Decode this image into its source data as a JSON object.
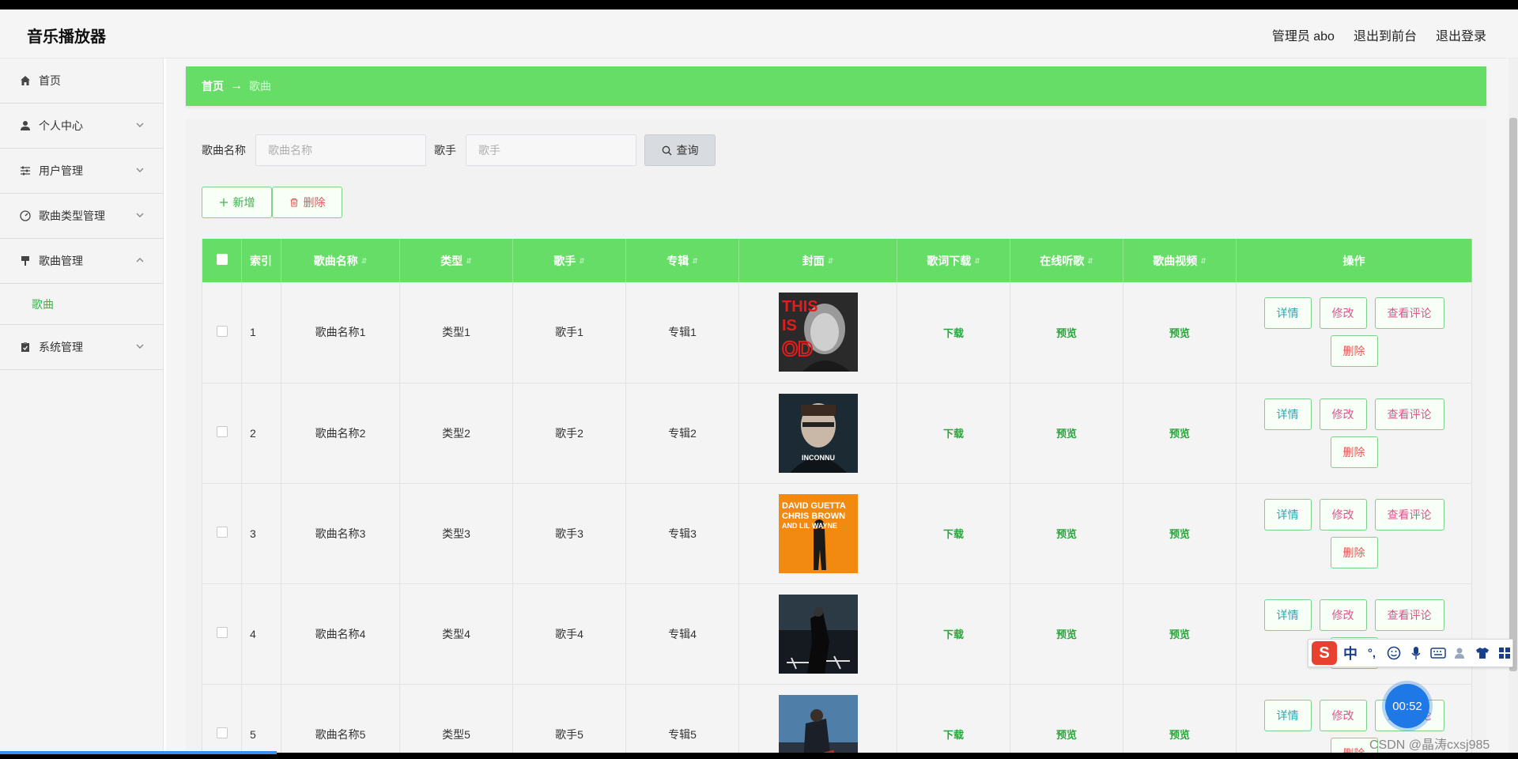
{
  "header": {
    "app_title": "音乐播放器",
    "admin_label": "管理员 abo",
    "to_front": "退出到前台",
    "logout": "退出登录"
  },
  "sidebar": {
    "items": [
      {
        "label": "首页",
        "icon": "home-icon"
      },
      {
        "label": "个人中心",
        "icon": "user-icon"
      },
      {
        "label": "用户管理",
        "icon": "sliders-icon"
      },
      {
        "label": "歌曲类型管理",
        "icon": "gauge-icon"
      },
      {
        "label": "歌曲管理",
        "icon": "pin-icon"
      },
      {
        "label": "系统管理",
        "icon": "clipboard-icon"
      }
    ],
    "sub_song": "歌曲"
  },
  "breadcrumb": {
    "home": "首页",
    "arrow": "→",
    "current": "歌曲"
  },
  "search": {
    "song_label": "歌曲名称",
    "song_placeholder": "歌曲名称",
    "singer_label": "歌手",
    "singer_placeholder": "歌手",
    "query": "查询"
  },
  "actions": {
    "add": "新增",
    "delete": "删除"
  },
  "table": {
    "headers": [
      "索引",
      "歌曲名称",
      "类型",
      "歌手",
      "专辑",
      "封面",
      "歌词下载",
      "在线听歌",
      "歌曲视频",
      "操作"
    ],
    "rows": [
      {
        "index": "1",
        "name": "歌曲名称1",
        "type": "类型1",
        "singer": "歌手1",
        "album": "专辑1",
        "download": "下载",
        "listen": "预览",
        "video": "预览"
      },
      {
        "index": "2",
        "name": "歌曲名称2",
        "type": "类型2",
        "singer": "歌手2",
        "album": "专辑2",
        "download": "下载",
        "listen": "预览",
        "video": "预览"
      },
      {
        "index": "3",
        "name": "歌曲名称3",
        "type": "类型3",
        "singer": "歌手3",
        "album": "专辑3",
        "download": "下载",
        "listen": "预览",
        "video": "预览"
      },
      {
        "index": "4",
        "name": "歌曲名称4",
        "type": "类型4",
        "singer": "歌手4",
        "album": "专辑4",
        "download": "下载",
        "listen": "预览",
        "video": "预览"
      },
      {
        "index": "5",
        "name": "歌曲名称5",
        "type": "类型5",
        "singer": "歌手5",
        "album": "专辑5",
        "download": "下载",
        "listen": "预览",
        "video": "预览"
      }
    ],
    "op_labels": {
      "detail": "详情",
      "edit": "修改",
      "comment": "查看评论",
      "delete": "删除"
    }
  },
  "covers": [
    {
      "text1": "THIS",
      "text2": "IS",
      "text3": "OD"
    },
    {
      "text1": "INCONNU"
    },
    {
      "text1": "DAVID GUETTA",
      "text2": "CHRIS BROWN",
      "text3": "AND LIL WAYNE"
    },
    {
      "text1": ""
    },
    {
      "text1": ""
    }
  ],
  "overlay": {
    "ime_logo": "S",
    "ime_zh": "中",
    "ime_punct": "°,",
    "timer": "00:52",
    "watermark": "CSDN @晶涛cxsj985"
  },
  "colors": {
    "accent_green": "#66dd66",
    "link_green": "#2aa53b",
    "delete_red": "#e05a5a",
    "edit_pink": "#e0538e",
    "detail_teal": "#2aa5b8"
  }
}
